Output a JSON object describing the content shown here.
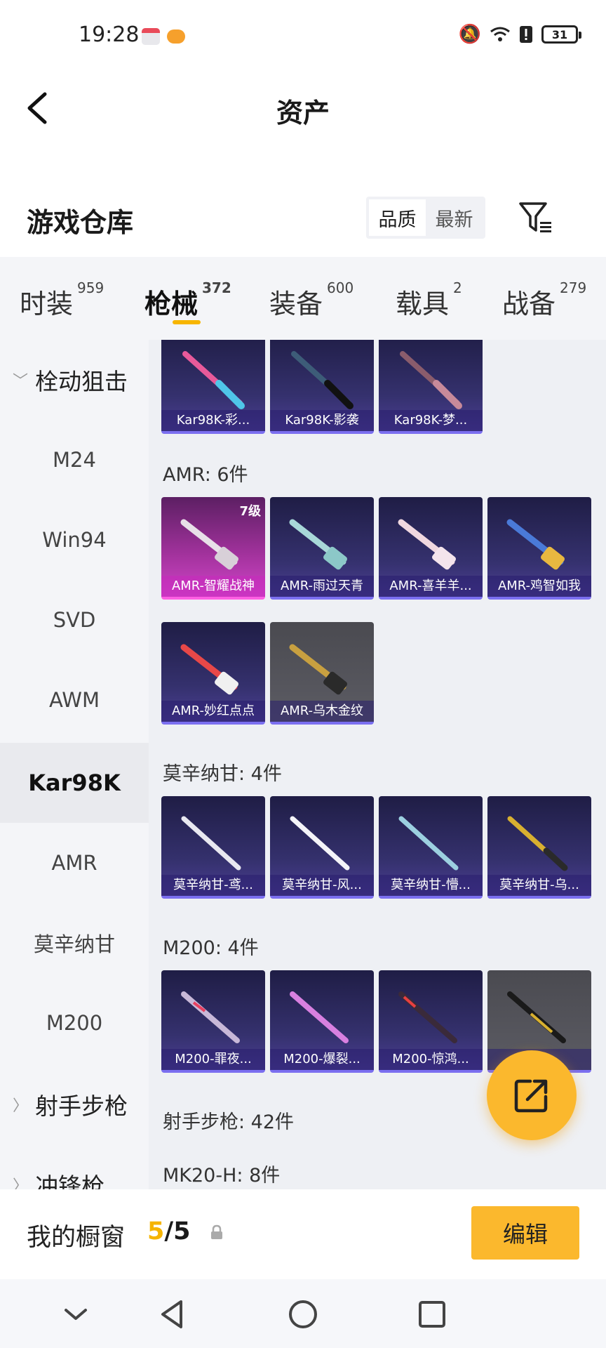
{
  "status_bar": {
    "time": "19:28",
    "battery": "31"
  },
  "header": {
    "title": "资产"
  },
  "warehouse": {
    "title": "游戏仓库",
    "sort_options": [
      "品质",
      "最新"
    ]
  },
  "tabs": [
    {
      "label": "时装",
      "count": "959"
    },
    {
      "label": "枪械",
      "count": "372"
    },
    {
      "label": "装备",
      "count": "600"
    },
    {
      "label": "载具",
      "count": "2"
    },
    {
      "label": "战备",
      "count": "279"
    }
  ],
  "sidebar": {
    "group1": "栓动狙击",
    "items": [
      "M24",
      "Win94",
      "SVD",
      "AWM",
      "Kar98K",
      "AMR",
      "莫辛纳甘",
      "M200"
    ],
    "group2": "射手步枪",
    "group3": "冲锋枪"
  },
  "sections": {
    "kar98k_cards": [
      "Kar98K-彩...",
      "Kar98K-影袭",
      "Kar98K-梦..."
    ],
    "amr": {
      "label": "AMR: 6件",
      "cards": [
        "AMR-智耀战神",
        "AMR-雨过天青",
        "AMR-喜羊羊...",
        "AMR-鸡智如我",
        "AMR-妙红点点",
        "AMR-乌木金纹"
      ],
      "level_badge": "7级"
    },
    "mosin": {
      "label": "莫辛纳甘: 4件",
      "cards": [
        "莫辛纳甘-鸢...",
        "莫辛纳甘-风...",
        "莫辛纳甘-懵...",
        "莫辛纳甘-乌..."
      ]
    },
    "m200": {
      "label": "M200: 4件",
      "cards": [
        "M200-罪夜...",
        "M200-爆裂...",
        "M200-惊鸿...",
        "..."
      ]
    },
    "dmr_label": "射手步枪: 42件",
    "mk20_label": "MK20-H: 8件"
  },
  "window_bar": {
    "label": "我的橱窗",
    "current": "5",
    "total": "/5",
    "edit_label": "编辑"
  },
  "colors": {
    "accent": "#f7b500",
    "card_purple": "#35316e",
    "card_pink": "#a5339f"
  },
  "icons": [
    "back-arrow-icon",
    "filter-icon",
    "share-export-icon",
    "lock-icon",
    "nav-down-icon",
    "nav-back-icon",
    "nav-home-icon",
    "nav-recents-icon"
  ]
}
